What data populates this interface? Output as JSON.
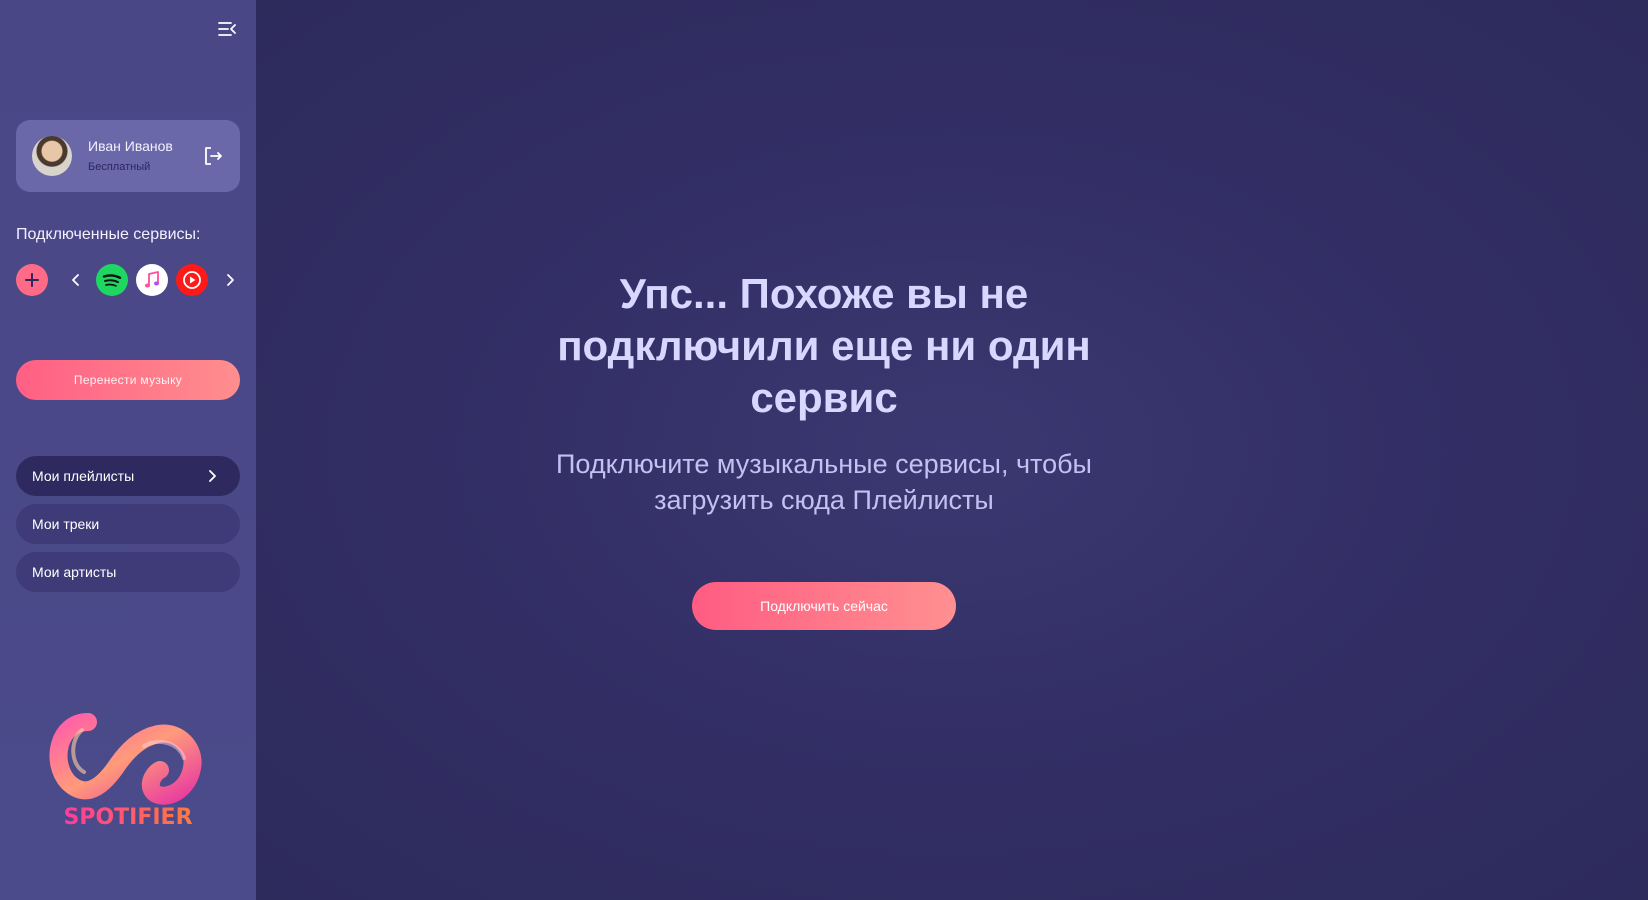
{
  "sidebar": {
    "user": {
      "name": "Иван Иванов",
      "plan": "Бесплатный"
    },
    "services_title": "Подключенные сервисы:",
    "services": [
      "spotify-icon",
      "apple-music-icon",
      "youtube-music-icon"
    ],
    "transfer_label": "Перенести музыку",
    "nav": [
      {
        "label": "Мои плейлисты"
      },
      {
        "label": "Мои треки"
      },
      {
        "label": "Мои артисты"
      }
    ],
    "logo_text": "SPOTIFIER"
  },
  "main": {
    "headline": "Упс... Похоже вы не подключили еще ни один сервис",
    "subline": "Подключите музыкальные сервисы, чтобы загрузить сюда Плейлисты",
    "connect_label": "Подключить сейчас"
  },
  "colors": {
    "accent": "#ff6b86",
    "sidebar_bg": "#4a4786",
    "main_bg": "#2f2b5e",
    "headline": "#d9d6ff"
  }
}
